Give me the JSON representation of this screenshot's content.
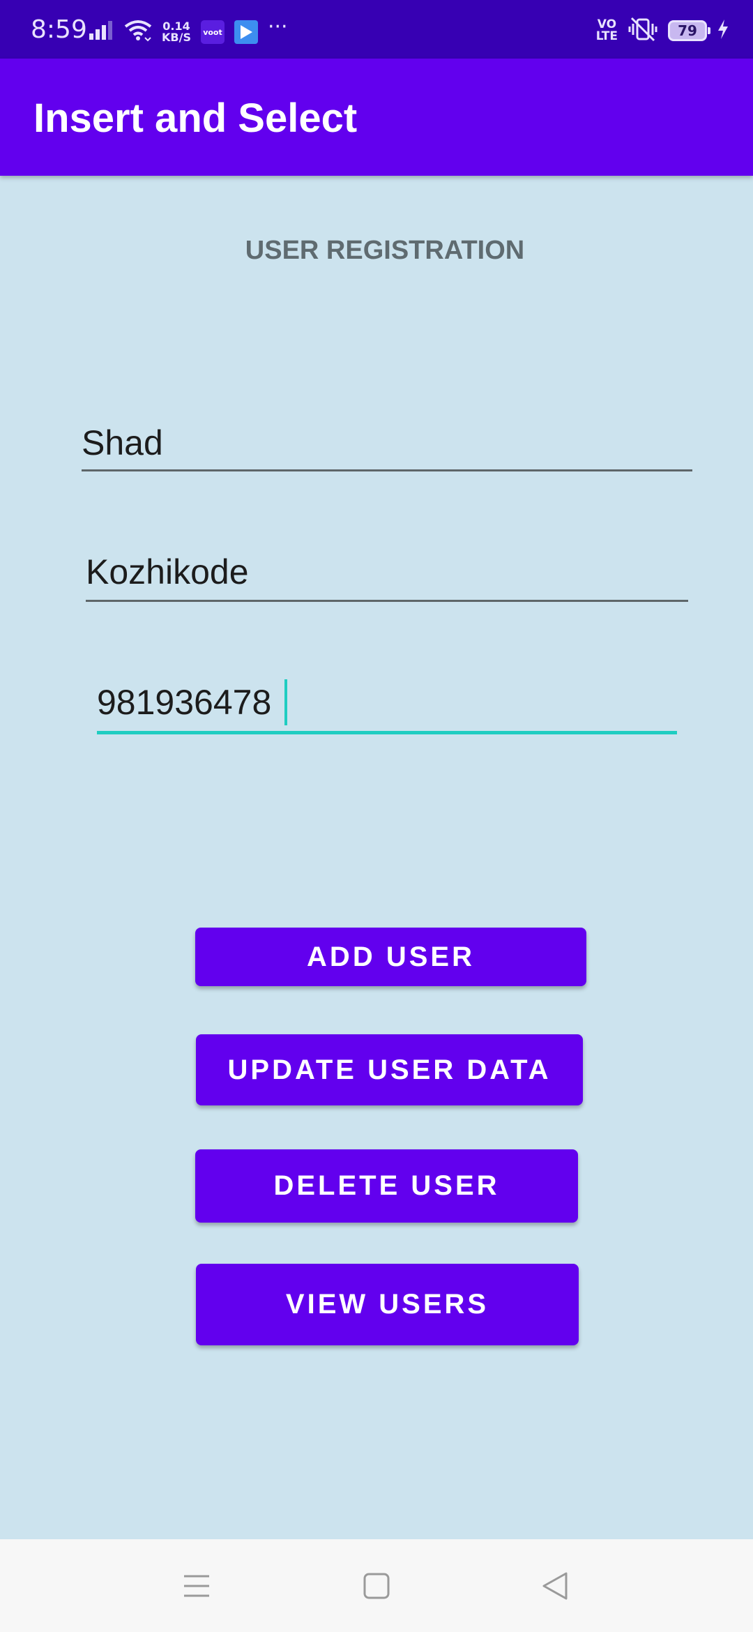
{
  "status_bar": {
    "time": "8:59",
    "net_speed_value": "0.14",
    "net_speed_unit": "KB/S",
    "voot_label": "voot",
    "more_label": "···",
    "volte_top": "VO",
    "volte_bottom": "LTE",
    "battery": "79",
    "icons": [
      "signal-icon",
      "wifi-icon",
      "voot-app-icon",
      "play-store-icon",
      "more-dots-icon",
      "volte-icon",
      "vibrate-mute-icon",
      "battery-icon",
      "charging-bolt-icon"
    ]
  },
  "app_bar": {
    "title": "Insert and Select",
    "color": "#6200ee"
  },
  "form": {
    "heading": "USER REGISTRATION",
    "name_value": "Shad",
    "place_value": "Kozhikode",
    "phone_value": "981936478",
    "focus_color": "#1fcdc1"
  },
  "buttons": {
    "add": "ADD USER",
    "update": "UPDATE USER DATA",
    "delete": "DELETE USER",
    "view": "VIEW USERS",
    "color": "#6200ee"
  },
  "nav_bar": {
    "icons": [
      "menu-icon",
      "home-icon",
      "back-icon"
    ]
  },
  "colors": {
    "status_bar": "#3700b3",
    "background": "#cce3ee"
  }
}
